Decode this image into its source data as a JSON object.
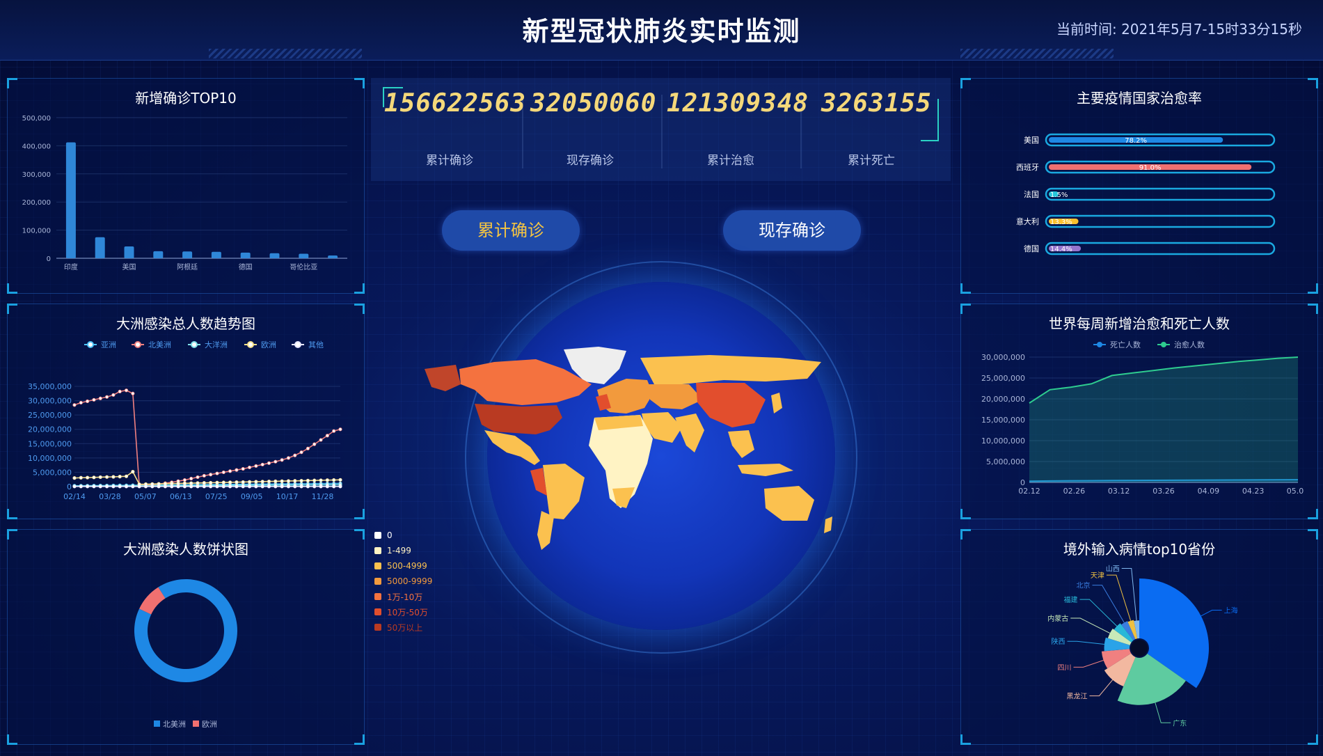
{
  "header": {
    "title": "新型冠状肺炎实时监测",
    "time": "当前时间: 2021年5月7-15时33分15秒"
  },
  "stats": [
    {
      "value": "156622563",
      "label": "累计确诊"
    },
    {
      "value": "32050060",
      "label": "现存确诊"
    },
    {
      "value": "121309348",
      "label": "累计治愈"
    },
    {
      "value": "3263155",
      "label": "累计死亡"
    }
  ],
  "buttons": {
    "cumulative": "累计确诊",
    "current": "现存确诊"
  },
  "map_legend": [
    {
      "label": "0",
      "color": "#ffffff"
    },
    {
      "label": "1-499",
      "color": "#fff3c4"
    },
    {
      "label": "500-4999",
      "color": "#fbc14f"
    },
    {
      "label": "5000-9999",
      "color": "#f29a3d"
    },
    {
      "label": "1万-10万",
      "color": "#f4723f"
    },
    {
      "label": "10万-50万",
      "color": "#e24e2d"
    },
    {
      "label": "50万以上",
      "color": "#b93a22"
    }
  ],
  "chart_data": [
    {
      "id": "top10",
      "type": "bar",
      "title": "新增确诊TOP10",
      "categories": [
        "印度",
        "",
        "美国",
        "",
        "阿根廷",
        "",
        "德国",
        "",
        "哥伦比亚",
        ""
      ],
      "values": [
        412000,
        75000,
        42000,
        25000,
        24000,
        23000,
        20000,
        18000,
        16000,
        10000
      ],
      "ylim": [
        0,
        500000
      ],
      "yticks": [
        "0",
        "100,000",
        "200,000",
        "300,000",
        "400,000",
        "500,000"
      ],
      "color": "#2f87d8"
    },
    {
      "id": "continent-trend",
      "type": "line",
      "title": "大洲感染总人数趋势图",
      "x_ticks": [
        "02/14",
        "03/28",
        "05/07",
        "06/13",
        "07/25",
        "09/05",
        "10/17",
        "11/28"
      ],
      "ylim": [
        0,
        35000000
      ],
      "yticks": [
        "0",
        "5,000,000",
        "10,000,000",
        "15,000,000",
        "20,000,000",
        "25,000,000",
        "30,000,000",
        "35,000,000"
      ],
      "series": [
        {
          "name": "亚洲",
          "color": "#4fc3f7",
          "values": [
            300000,
            310000,
            320000,
            340000,
            360000,
            380000,
            400000,
            420000,
            440000,
            460000,
            480000,
            500000,
            520000,
            540000,
            560000,
            580000,
            600000,
            620000,
            640000,
            660000,
            680000,
            700000,
            720000,
            740000,
            760000,
            780000,
            800000,
            820000,
            840000,
            860000,
            880000,
            900000,
            920000,
            940000,
            960000,
            980000,
            1000000,
            1020000,
            1040000,
            1060000,
            1080000,
            1100000
          ]
        },
        {
          "name": "北美洲",
          "color": "#f08080",
          "values": [
            28500000,
            29300000,
            29800000,
            30300000,
            30800000,
            31300000,
            32000000,
            33200000,
            33600000,
            32500000,
            300000,
            500000,
            700000,
            900000,
            1200000,
            1500000,
            1900000,
            2300000,
            2800000,
            3300000,
            3800000,
            4200000,
            4600000,
            5000000,
            5400000,
            5800000,
            6200000,
            6700000,
            7200000,
            7700000,
            8200000,
            8700000,
            9300000,
            10000000,
            10900000,
            12000000,
            13300000,
            14800000,
            16300000,
            17800000,
            19400000,
            20000000
          ]
        },
        {
          "name": "大洋洲",
          "color": "#7fe0e8",
          "values": [
            200000,
            210000,
            220000,
            230000,
            240000,
            250000,
            260000,
            270000,
            280000,
            290000,
            300000,
            310000,
            320000,
            330000,
            340000,
            350000,
            360000,
            370000,
            380000,
            390000,
            400000,
            410000,
            420000,
            430000,
            440000,
            450000,
            460000,
            470000,
            480000,
            490000,
            500000,
            510000,
            520000,
            530000,
            540000,
            550000,
            560000,
            570000,
            580000,
            590000,
            600000,
            610000
          ]
        },
        {
          "name": "欧洲",
          "color": "#f7e08b",
          "values": [
            3000000,
            3100000,
            3150000,
            3200000,
            3300000,
            3350000,
            3400000,
            3500000,
            3600000,
            5200000,
            800000,
            850000,
            900000,
            950000,
            1000000,
            1050000,
            1100000,
            1150000,
            1200000,
            1250000,
            1300000,
            1350000,
            1400000,
            1450000,
            1500000,
            1550000,
            1600000,
            1650000,
            1700000,
            1750000,
            1800000,
            1850000,
            1900000,
            1950000,
            2000000,
            2050000,
            2100000,
            2150000,
            2200000,
            2250000,
            2300000,
            2350000
          ]
        },
        {
          "name": "其他",
          "color": "#e6e6ff",
          "values": [
            50000,
            50000,
            50000,
            50000,
            50000,
            50000,
            50000,
            50000,
            50000,
            50000,
            50000,
            50000,
            50000,
            50000,
            50000,
            50000,
            50000,
            50000,
            50000,
            50000,
            50000,
            50000,
            50000,
            50000,
            50000,
            50000,
            50000,
            50000,
            50000,
            50000,
            50000,
            50000,
            50000,
            50000,
            50000,
            50000,
            50000,
            50000,
            50000,
            50000,
            50000,
            50000
          ]
        }
      ]
    },
    {
      "id": "continent-pie",
      "type": "pie",
      "title": "大洲感染人数饼状图",
      "slices": [
        {
          "name": "北美洲",
          "value": 91,
          "color": "#1e88e5"
        },
        {
          "name": "欧洲",
          "value": 9,
          "color": "#f07070"
        }
      ]
    },
    {
      "id": "cure-rate",
      "type": "bar",
      "title": "主要疫情国家治愈率",
      "categories": [
        "美国",
        "西班牙",
        "法国",
        "意大利",
        "德国"
      ],
      "values": [
        78.2,
        91.0,
        1.5,
        13.3,
        14.4
      ],
      "labels": [
        "78.2%",
        "91.0%",
        "1.5%",
        "13.3%",
        "14.4%"
      ],
      "colors": [
        "#1e88e5",
        "#f07070",
        "#26c6da",
        "#fbc02d",
        "#9575cd"
      ],
      "track_color": "#1aa9e0",
      "ylim": [
        0,
        100
      ]
    },
    {
      "id": "weekly",
      "type": "area",
      "title": "世界每周新增治愈和死亡人数",
      "x_ticks": [
        "02.12",
        "02.26",
        "03.12",
        "03.26",
        "04.09",
        "04.23",
        "05.0"
      ],
      "ylim": [
        0,
        30000000
      ],
      "yticks": [
        "0",
        "5,000,000",
        "10,000,000",
        "15,000,000",
        "20,000,000",
        "25,000,000",
        "30,000,000"
      ],
      "series": [
        {
          "name": "死亡人数",
          "color": "#1e88e5",
          "values": [
            300000,
            350000,
            400000,
            420000,
            450000,
            480000,
            500000,
            520000,
            540000,
            560000,
            580000,
            600000,
            620000,
            640000
          ]
        },
        {
          "name": "治愈人数",
          "color": "#2ecc8f",
          "values": [
            19000000,
            22200000,
            22800000,
            23600000,
            25600000,
            26200000,
            26800000,
            27400000,
            27900000,
            28400000,
            28900000,
            29300000,
            29700000,
            30000000
          ]
        }
      ]
    },
    {
      "id": "imports",
      "type": "pie",
      "title": "境外输入病情top10省份",
      "slices": [
        {
          "name": "上海",
          "value": 100,
          "color": "#0a6cf2"
        },
        {
          "name": "广东",
          "value": 62,
          "color": "#5ecba0"
        },
        {
          "name": "黑龙江",
          "value": 28,
          "color": "#f2b8a0"
        },
        {
          "name": "四川",
          "value": 22,
          "color": "#f08080"
        },
        {
          "name": "陕西",
          "value": 18,
          "color": "#2aa3e8"
        },
        {
          "name": "内蒙古",
          "value": 15,
          "color": "#c7e9b8"
        },
        {
          "name": "福建",
          "value": 13,
          "color": "#28b8d8"
        },
        {
          "name": "北京",
          "value": 11,
          "color": "#3a7de0"
        },
        {
          "name": "天津",
          "value": 10,
          "color": "#f0c040"
        },
        {
          "name": "山西",
          "value": 9,
          "color": "#80b8f0"
        }
      ]
    }
  ]
}
